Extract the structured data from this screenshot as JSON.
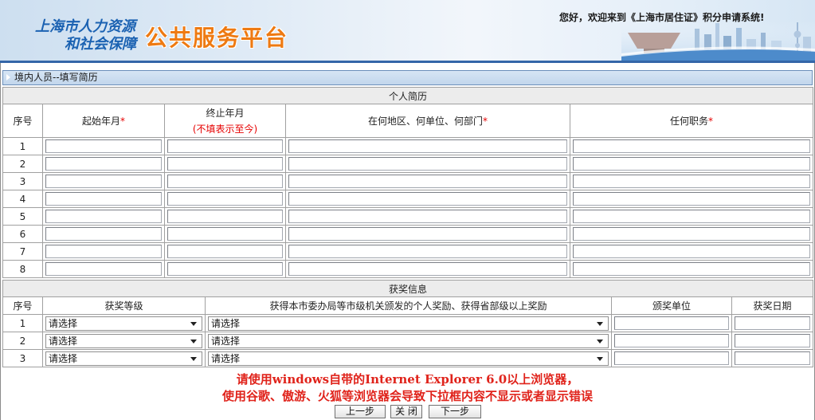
{
  "header": {
    "logo_line1": "上海市人力资源",
    "logo_line2": "和社会保障",
    "platform_title": "公共服务平台",
    "welcome_text": "您好，欢迎来到《上海市居住证》积分申请系统!"
  },
  "section_bar": {
    "title": "境内人员--填写简历",
    "icon": "triangle-right-icon"
  },
  "resume": {
    "title": "个人简历",
    "required_mark": "*",
    "columns": {
      "index": "序号",
      "start_month": "起始年月",
      "end_month": "终止年月",
      "end_month_note": "(不填表示至今)",
      "location": "在何地区、何单位、何部门",
      "position": "任何职务"
    },
    "rows": [
      {
        "index": "1",
        "start_month": "",
        "end_month": "",
        "location": "",
        "position": ""
      },
      {
        "index": "2",
        "start_month": "",
        "end_month": "",
        "location": "",
        "position": ""
      },
      {
        "index": "3",
        "start_month": "",
        "end_month": "",
        "location": "",
        "position": ""
      },
      {
        "index": "4",
        "start_month": "",
        "end_month": "",
        "location": "",
        "position": ""
      },
      {
        "index": "5",
        "start_month": "",
        "end_month": "",
        "location": "",
        "position": ""
      },
      {
        "index": "6",
        "start_month": "",
        "end_month": "",
        "location": "",
        "position": ""
      },
      {
        "index": "7",
        "start_month": "",
        "end_month": "",
        "location": "",
        "position": ""
      },
      {
        "index": "8",
        "start_month": "",
        "end_month": "",
        "location": "",
        "position": ""
      }
    ]
  },
  "awards": {
    "title": "获奖信息",
    "columns": {
      "index": "序号",
      "level": "获奖等级",
      "award": "获得本市委办局等市级机关颁发的个人奖励、获得省部级以上奖励",
      "issuer": "颁奖单位",
      "date": "获奖日期"
    },
    "rows": [
      {
        "index": "1",
        "level": "请选择",
        "award": "请选择",
        "issuer": "",
        "date": ""
      },
      {
        "index": "2",
        "level": "请选择",
        "award": "请选择",
        "issuer": "",
        "date": ""
      },
      {
        "index": "3",
        "level": "请选择",
        "award": "请选择",
        "issuer": "",
        "date": ""
      }
    ]
  },
  "notice": {
    "line1": "请使用windows自带的Internet Explorer 6.0以上浏览器，",
    "line2": "使用谷歌、傲游、火狐等浏览器会导致下拉框内容不显示或者显示错误"
  },
  "buttons": {
    "prev": "上一步",
    "close": "关 闭",
    "next": "下一步"
  },
  "colors": {
    "header_rule": "#3466a8",
    "logo_blue": "#1b62b2",
    "platform_orange": "#ee7a12",
    "section_bar": "#c9dcf0",
    "title_row_bg": "#ececec",
    "required_red": "#e60000",
    "notice_red": "#e0231b"
  }
}
